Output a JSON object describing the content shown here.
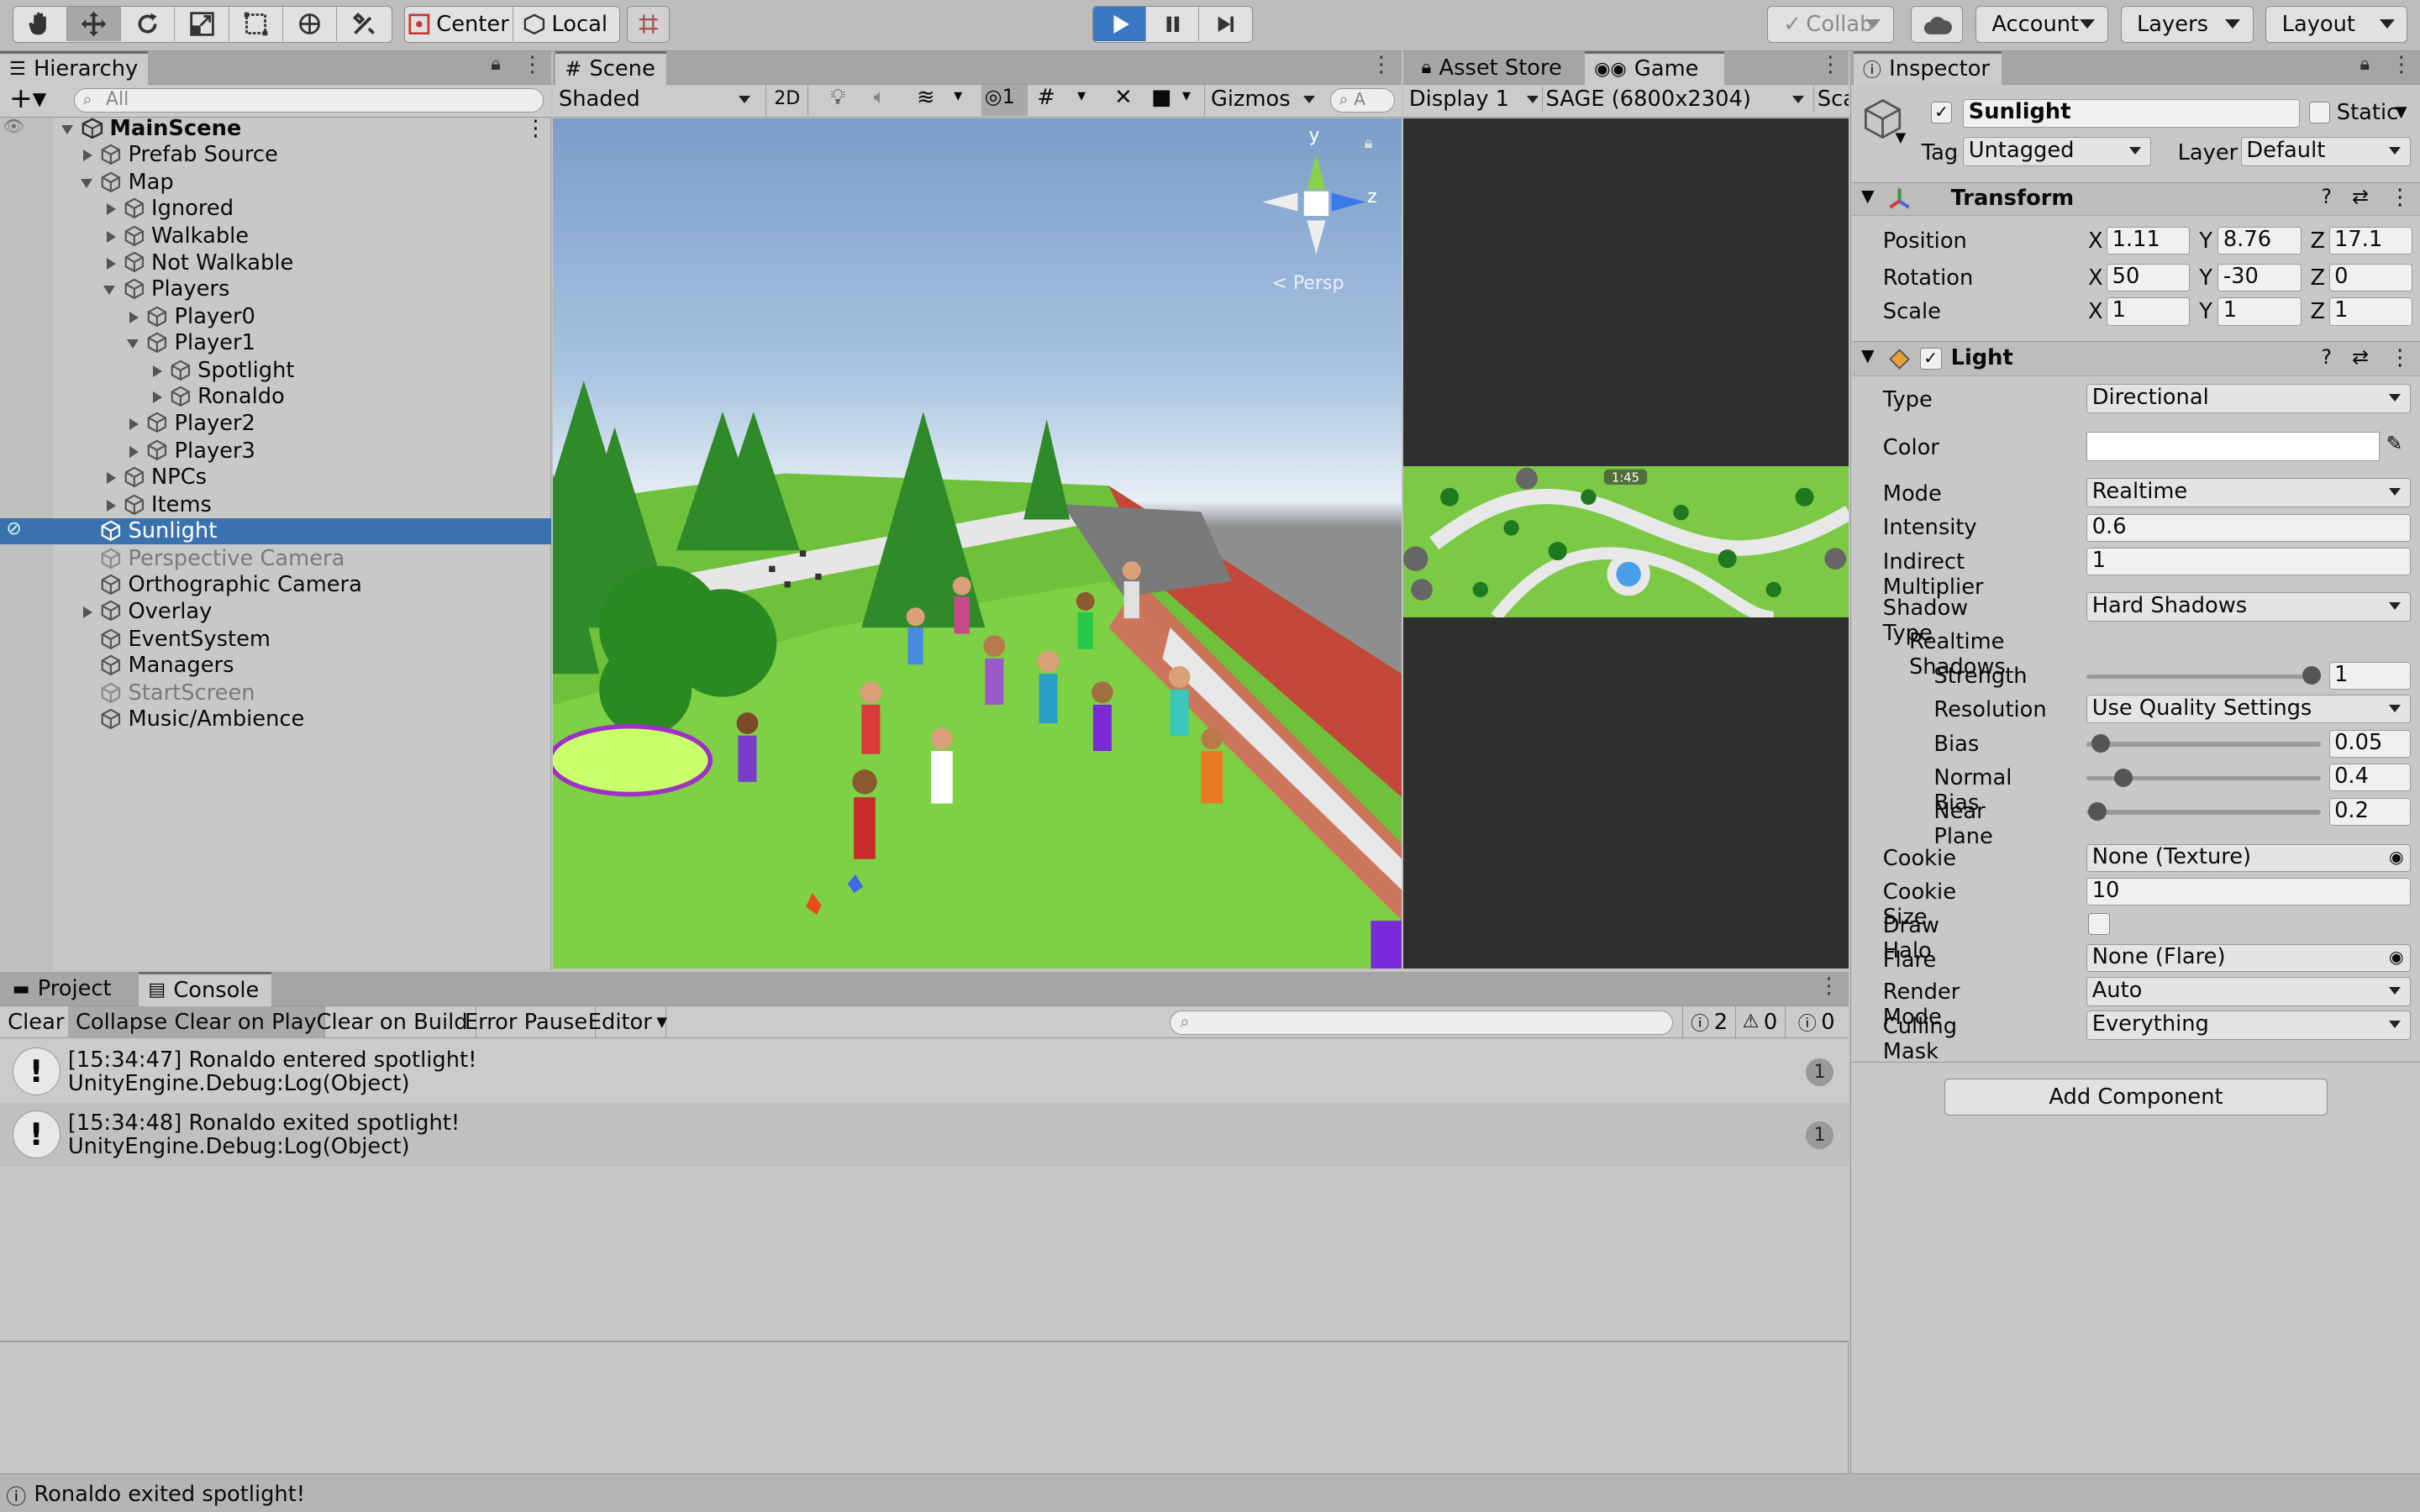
{
  "toolbar": {
    "pivot_label": "Center",
    "space_label": "Local",
    "collab_label": "Collab",
    "account_label": "Account",
    "layers_label": "Layers",
    "layout_label": "Layout"
  },
  "hierarchy": {
    "tab": "Hierarchy",
    "search_placeholder": "All",
    "items": [
      {
        "label": "MainScene"
      },
      {
        "label": "Prefab Source"
      },
      {
        "label": "Map"
      },
      {
        "label": "Ignored"
      },
      {
        "label": "Walkable"
      },
      {
        "label": "Not Walkable"
      },
      {
        "label": "Players"
      },
      {
        "label": "Player0"
      },
      {
        "label": "Player1"
      },
      {
        "label": "Spotlight"
      },
      {
        "label": "Ronaldo"
      },
      {
        "label": "Player2"
      },
      {
        "label": "Player3"
      },
      {
        "label": "NPCs"
      },
      {
        "label": "Items"
      },
      {
        "label": "Sunlight"
      },
      {
        "label": "Perspective Camera"
      },
      {
        "label": "Orthographic Camera"
      },
      {
        "label": "Overlay"
      },
      {
        "label": "EventSystem"
      },
      {
        "label": "Managers"
      },
      {
        "label": "StartScreen"
      },
      {
        "label": "Music/Ambience"
      }
    ]
  },
  "scene": {
    "tab": "Scene",
    "shading": "Shaded",
    "mode2d": "2D",
    "hidden_count": "1",
    "gizmos": "Gizmos",
    "search_placeholder": "A",
    "axis_y": "y",
    "axis_z": "z",
    "persp": "< Persp"
  },
  "game": {
    "asset_store_tab": "Asset Store",
    "tab": "Game",
    "display": "Display 1",
    "resolution": "SAGE (6800x2304)",
    "scale_label": "Sca",
    "timer": "1:45"
  },
  "inspector": {
    "tab": "Inspector",
    "object_name": "Sunlight",
    "static_label": "Static",
    "tag_label": "Tag",
    "tag_value": "Untagged",
    "layer_label": "Layer",
    "layer_value": "Default",
    "transform": {
      "title": "Transform",
      "position_label": "Position",
      "rotation_label": "Rotation",
      "scale_label": "Scale",
      "x": "X",
      "y": "Y",
      "z": "Z",
      "position": [
        "1.11",
        "8.76",
        "17.1"
      ],
      "rotation": [
        "50",
        "-30",
        "0"
      ],
      "scale": [
        "1",
        "1",
        "1"
      ]
    },
    "light": {
      "title": "Light",
      "type_label": "Type",
      "type_value": "Directional",
      "color_label": "Color",
      "color_value": "#ffffff",
      "mode_label": "Mode",
      "mode_value": "Realtime",
      "intensity_label": "Intensity",
      "intensity_value": "0.6",
      "indirect_label": "Indirect Multiplier",
      "indirect_value": "1",
      "shadow_type_label": "Shadow Type",
      "shadow_type_value": "Hard Shadows",
      "realtime_shadows_label": "Realtime Shadows",
      "strength_label": "Strength",
      "strength_value": "1",
      "strength_fraction": 1.0,
      "resolution_label": "Resolution",
      "resolution_value": "Use Quality Settings",
      "bias_label": "Bias",
      "bias_value": "0.05",
      "bias_fraction": 0.025,
      "normal_bias_label": "Normal Bias",
      "normal_bias_value": "0.4",
      "normal_bias_fraction": 0.13,
      "near_plane_label": "Near Plane",
      "near_plane_value": "0.2",
      "near_plane_fraction": 0.0,
      "cookie_label": "Cookie",
      "cookie_value": "None (Texture)",
      "cookie_size_label": "Cookie Size",
      "cookie_size_value": "10",
      "draw_halo_label": "Draw Halo",
      "flare_label": "Flare",
      "flare_value": "None (Flare)",
      "render_mode_label": "Render Mode",
      "render_mode_value": "Auto",
      "culling_mask_label": "Culling Mask",
      "culling_mask_value": "Everything"
    },
    "add_component": "Add Component"
  },
  "console": {
    "project_tab": "Project",
    "console_tab": "Console",
    "buttons": [
      "Clear",
      "Collapse",
      "Clear on Play",
      "Clear on Build",
      "Error Pause",
      "Editor"
    ],
    "counts": {
      "info": "2",
      "warn": "0",
      "error": "0"
    },
    "logs": [
      {
        "line1": "[15:34:47] Ronaldo entered spotlight!",
        "line2": "UnityEngine.Debug:Log(Object)",
        "count": "1"
      },
      {
        "line1": "[15:34:48] Ronaldo exited spotlight!",
        "line2": "UnityEngine.Debug:Log(Object)",
        "count": "1"
      }
    ]
  },
  "status_bar": {
    "message": "Ronaldo exited spotlight!"
  }
}
